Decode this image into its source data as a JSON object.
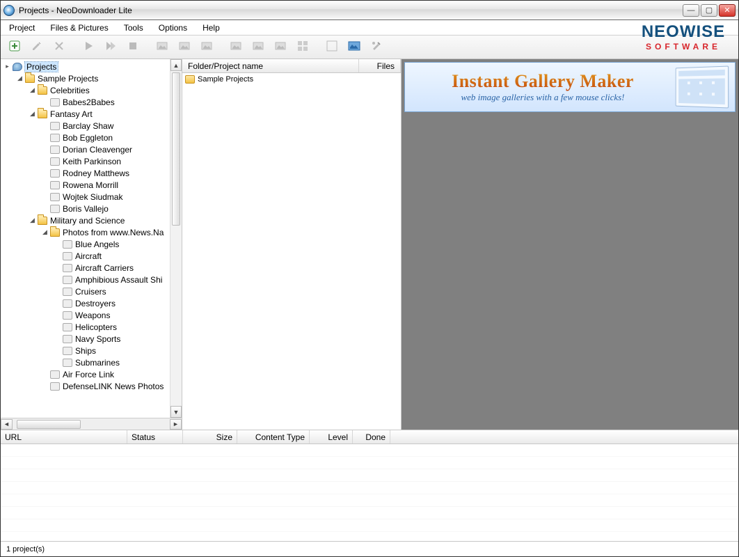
{
  "window": {
    "title": "Projects - NeoDownloader Lite"
  },
  "brand": {
    "line1": "NEOWISE",
    "line2": "SOFTWARE"
  },
  "menu": {
    "items": [
      "Project",
      "Files & Pictures",
      "Tools",
      "Options",
      "Help"
    ]
  },
  "toolbar": {
    "buttons": [
      "new-project",
      "edit-project",
      "delete-project",
      "sep",
      "play",
      "play-all",
      "stop",
      "sep",
      "image-a",
      "image-b",
      "image-c",
      "sep",
      "image-d",
      "image-e",
      "image-f",
      "grid-view",
      "sep",
      "fullscreen-a",
      "fullscreen-b",
      "settings"
    ],
    "activeIndex": 16
  },
  "tree": {
    "rootLabel": "Projects",
    "nodes": [
      {
        "depth": 0,
        "toggle": "▸",
        "icon": "root",
        "label": "Projects",
        "root": true
      },
      {
        "depth": 1,
        "toggle": "◢",
        "icon": "folder",
        "label": "Sample Projects"
      },
      {
        "depth": 2,
        "toggle": "◢",
        "icon": "folder",
        "label": "Celebrities"
      },
      {
        "depth": 3,
        "toggle": "",
        "icon": "item",
        "label": "Babes2Babes"
      },
      {
        "depth": 2,
        "toggle": "◢",
        "icon": "folder",
        "label": "Fantasy Art"
      },
      {
        "depth": 3,
        "toggle": "",
        "icon": "item",
        "label": "Barclay Shaw"
      },
      {
        "depth": 3,
        "toggle": "",
        "icon": "item",
        "label": "Bob Eggleton"
      },
      {
        "depth": 3,
        "toggle": "",
        "icon": "item",
        "label": "Dorian Cleavenger"
      },
      {
        "depth": 3,
        "toggle": "",
        "icon": "item",
        "label": "Keith Parkinson"
      },
      {
        "depth": 3,
        "toggle": "",
        "icon": "item",
        "label": "Rodney Matthews"
      },
      {
        "depth": 3,
        "toggle": "",
        "icon": "item",
        "label": "Rowena Morrill"
      },
      {
        "depth": 3,
        "toggle": "",
        "icon": "item",
        "label": "Wojtek Siudmak"
      },
      {
        "depth": 3,
        "toggle": "",
        "icon": "item",
        "label": "Boris Vallejo"
      },
      {
        "depth": 2,
        "toggle": "◢",
        "icon": "folder",
        "label": "Military and Science"
      },
      {
        "depth": 3,
        "toggle": "◢",
        "icon": "folder",
        "label": "Photos from www.News.Na"
      },
      {
        "depth": 4,
        "toggle": "",
        "icon": "item",
        "label": "Blue Angels"
      },
      {
        "depth": 4,
        "toggle": "",
        "icon": "item",
        "label": "Aircraft"
      },
      {
        "depth": 4,
        "toggle": "",
        "icon": "item",
        "label": "Aircraft Carriers"
      },
      {
        "depth": 4,
        "toggle": "",
        "icon": "item",
        "label": "Amphibious Assault Shi"
      },
      {
        "depth": 4,
        "toggle": "",
        "icon": "item",
        "label": "Cruisers"
      },
      {
        "depth": 4,
        "toggle": "",
        "icon": "item",
        "label": "Destroyers"
      },
      {
        "depth": 4,
        "toggle": "",
        "icon": "item",
        "label": "Weapons"
      },
      {
        "depth": 4,
        "toggle": "",
        "icon": "item",
        "label": "Helicopters"
      },
      {
        "depth": 4,
        "toggle": "",
        "icon": "item",
        "label": "Navy Sports"
      },
      {
        "depth": 4,
        "toggle": "",
        "icon": "item",
        "label": "Ships"
      },
      {
        "depth": 4,
        "toggle": "",
        "icon": "item",
        "label": "Submarines"
      },
      {
        "depth": 3,
        "toggle": "",
        "icon": "item",
        "label": "Air Force Link"
      },
      {
        "depth": 3,
        "toggle": "",
        "icon": "item",
        "label": "DefenseLINK News Photos"
      }
    ]
  },
  "folderList": {
    "columns": {
      "name": "Folder/Project name",
      "files": "Files"
    },
    "rows": [
      {
        "name": "Sample Projects",
        "files": ""
      }
    ]
  },
  "ad": {
    "headline": "Instant Gallery Maker",
    "sub": "web image galleries with a few mouse clicks!"
  },
  "downloadGrid": {
    "columns": [
      "URL",
      "Status",
      "Size",
      "Content Type",
      "Level",
      "Done"
    ],
    "widths": [
      182,
      80,
      78,
      104,
      62,
      54
    ]
  },
  "status": {
    "text": "1 project(s)"
  }
}
